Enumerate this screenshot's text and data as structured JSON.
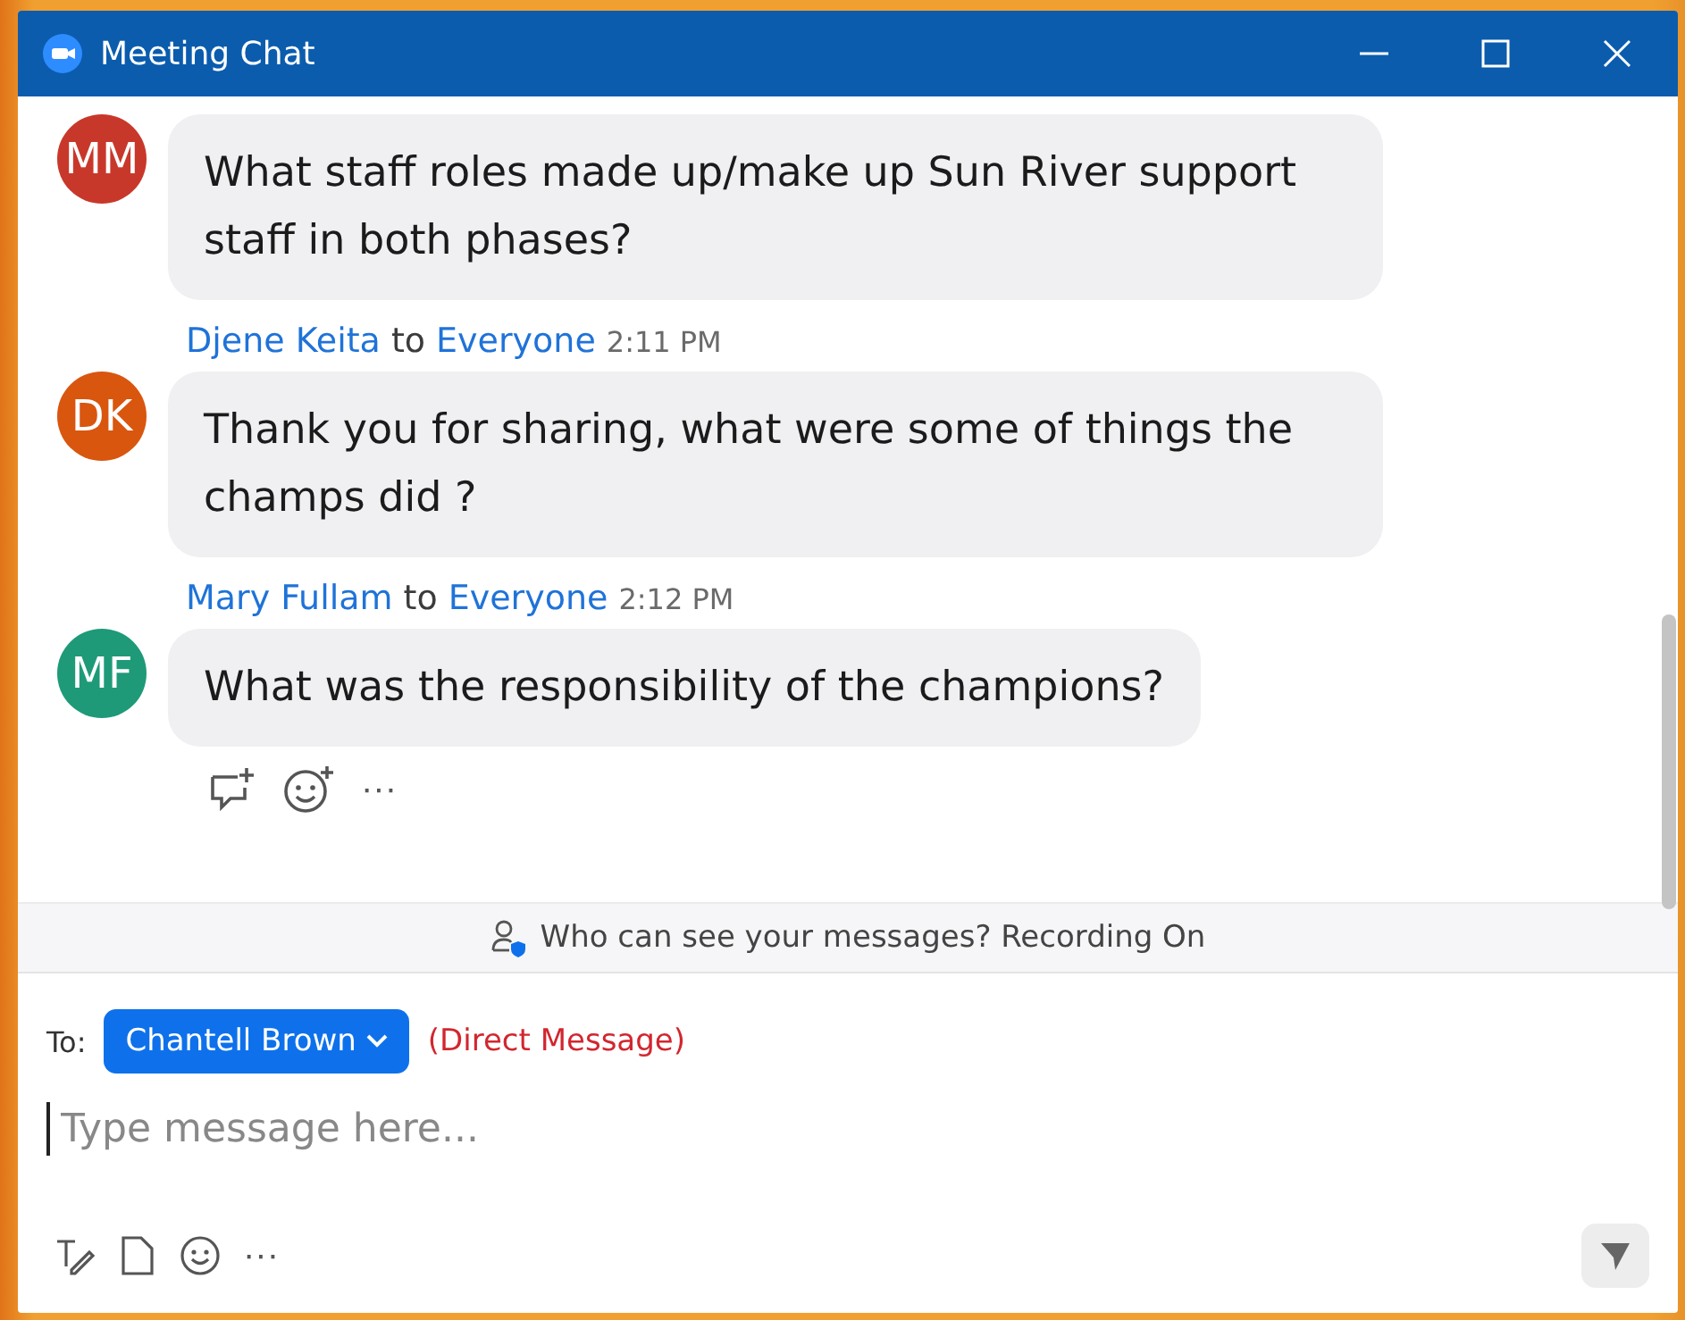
{
  "window": {
    "title": "Meeting Chat"
  },
  "messages": [
    {
      "initials": "MM",
      "color": "#c8382a",
      "text": "What staff roles made up/make up Sun River support staff in both phases?"
    },
    {
      "initials": "DK",
      "color": "#d9560f",
      "sender": "Djene Keita",
      "connector": "to",
      "recipient": "Everyone",
      "time": "2:11 PM",
      "text": "Thank you for sharing, what were some of things the champs did ?"
    },
    {
      "initials": "MF",
      "color": "#1e9a78",
      "sender": "Mary Fullam",
      "connector": "to",
      "recipient": "Everyone",
      "time": "2:12 PM",
      "text": "What was the responsibility of the champions?"
    }
  ],
  "message_actions": {
    "more": "···"
  },
  "notice": "Who can see your messages? Recording On",
  "compose": {
    "to_label": "To:",
    "recipient": "Chantell Brown",
    "dm_label": "(Direct Message)",
    "placeholder": "Type message here...",
    "more": "···"
  }
}
